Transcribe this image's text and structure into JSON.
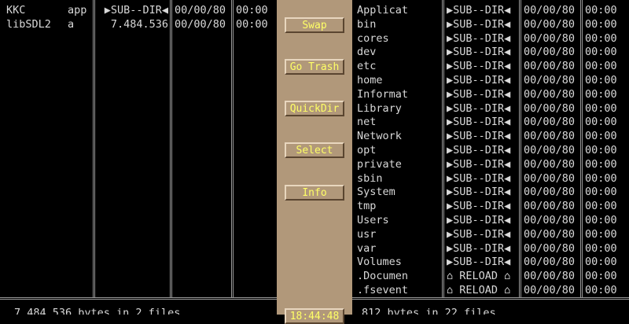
{
  "left_panel": {
    "rows": [
      {
        "name": "KKC",
        "ext": "app",
        "size": "▶SUB--DIR◀",
        "date": "00/00/80",
        "time": "00:00"
      },
      {
        "name": "libSDL2",
        "ext": "a",
        "size": "7.484.536",
        "date": "00/00/80",
        "time": "00:00"
      }
    ],
    "footer": "7.484.536 bytes in 2 files"
  },
  "middle_buttons": [
    {
      "label": "Swap"
    },
    {
      "label": "Go Trash"
    },
    {
      "label": "QuickDir"
    },
    {
      "label": "Select"
    },
    {
      "label": "Info"
    }
  ],
  "middle_clock": "18:44:48",
  "right_panel": {
    "rows": [
      {
        "name": "Applicat",
        "size": "▶SUB--DIR◀",
        "date": "00/00/80",
        "time": "00:00"
      },
      {
        "name": "bin",
        "size": "▶SUB--DIR◀",
        "date": "00/00/80",
        "time": "00:00"
      },
      {
        "name": "cores",
        "size": "▶SUB--DIR◀",
        "date": "00/00/80",
        "time": "00:00"
      },
      {
        "name": "dev",
        "size": "▶SUB--DIR◀",
        "date": "00/00/80",
        "time": "00:00"
      },
      {
        "name": "etc",
        "size": "▶SUB--DIR◀",
        "date": "00/00/80",
        "time": "00:00"
      },
      {
        "name": "home",
        "size": "▶SUB--DIR◀",
        "date": "00/00/80",
        "time": "00:00"
      },
      {
        "name": "Informat",
        "size": "▶SUB--DIR◀",
        "date": "00/00/80",
        "time": "00:00"
      },
      {
        "name": "Library",
        "size": "▶SUB--DIR◀",
        "date": "00/00/80",
        "time": "00:00"
      },
      {
        "name": "net",
        "size": "▶SUB--DIR◀",
        "date": "00/00/80",
        "time": "00:00"
      },
      {
        "name": "Network",
        "size": "▶SUB--DIR◀",
        "date": "00/00/80",
        "time": "00:00"
      },
      {
        "name": "opt",
        "size": "▶SUB--DIR◀",
        "date": "00/00/80",
        "time": "00:00"
      },
      {
        "name": "private",
        "size": "▶SUB--DIR◀",
        "date": "00/00/80",
        "time": "00:00"
      },
      {
        "name": "sbin",
        "size": "▶SUB--DIR◀",
        "date": "00/00/80",
        "time": "00:00"
      },
      {
        "name": "System",
        "size": "▶SUB--DIR◀",
        "date": "00/00/80",
        "time": "00:00"
      },
      {
        "name": "tmp",
        "size": "▶SUB--DIR◀",
        "date": "00/00/80",
        "time": "00:00"
      },
      {
        "name": "Users",
        "size": "▶SUB--DIR◀",
        "date": "00/00/80",
        "time": "00:00"
      },
      {
        "name": "usr",
        "size": "▶SUB--DIR◀",
        "date": "00/00/80",
        "time": "00:00"
      },
      {
        "name": "var",
        "size": "▶SUB--DIR◀",
        "date": "00/00/80",
        "time": "00:00"
      },
      {
        "name": "Volumes",
        "size": "▶SUB--DIR◀",
        "date": "00/00/80",
        "time": "00:00"
      },
      {
        "name": ".Documen",
        "size": "⌂ RELOAD ⌂",
        "date": "00/00/80",
        "time": "00:00"
      },
      {
        "name": ".fsevent",
        "size": "⌂ RELOAD ⌂",
        "date": "00/00/80",
        "time": "00:00"
      }
    ],
    "footer": "812 bytes in 22 files"
  },
  "colors": {
    "background": "#000000",
    "text": "#d8d8d8",
    "middle_bar": "#b1987a",
    "button_text": "#ffff66",
    "separator": "#9a9a9a"
  }
}
